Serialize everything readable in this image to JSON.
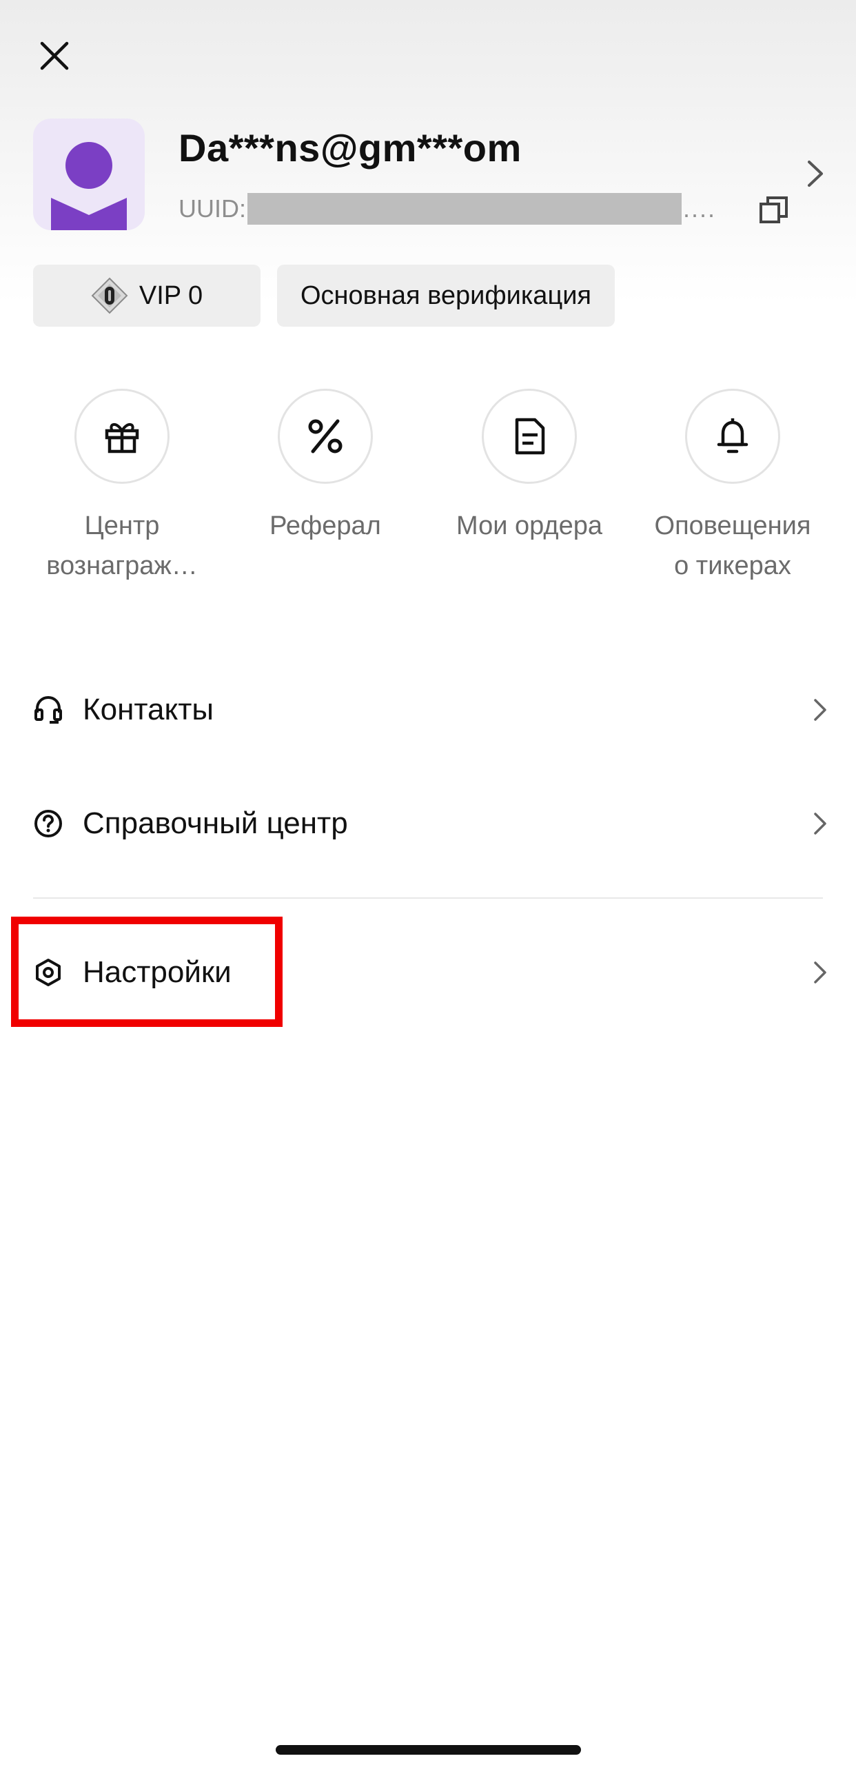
{
  "header": {
    "close_icon": "close-icon"
  },
  "profile": {
    "email": "Da***ns@gm***om",
    "uuid_label": "UUID:",
    "uuid_ellipsis": "....",
    "copy_icon": "copy-icon",
    "chevron_icon": "chevron-right-icon",
    "avatar_color": "#7b3fc4"
  },
  "badges": {
    "vip_label": "VIP 0",
    "verification_label": "Основная верификация"
  },
  "quick_actions": [
    {
      "label": "Центр\nвознаграж…",
      "icon": "gift-icon"
    },
    {
      "label": "Реферал",
      "icon": "percent-icon"
    },
    {
      "label": "Мои ордера",
      "icon": "document-icon"
    },
    {
      "label": "Оповещения\nо тикерах",
      "icon": "bell-icon"
    }
  ],
  "menu": [
    {
      "label": "Контакты",
      "icon": "headset-icon"
    },
    {
      "label": "Справочный центр",
      "icon": "help-circle-icon"
    },
    {
      "label": "Настройки",
      "icon": "settings-hexagon-icon"
    }
  ],
  "annotation": {
    "highlight_color": "#f00000"
  }
}
